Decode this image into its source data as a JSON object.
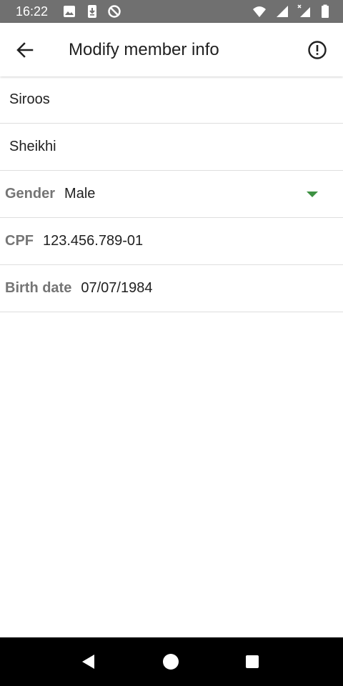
{
  "status_bar": {
    "time": "16:22",
    "icons": [
      "image-icon",
      "download-icon",
      "data-saver-icon",
      "wifi-icon",
      "signal-icon",
      "signal-no-data-icon",
      "battery-icon"
    ]
  },
  "app_bar": {
    "title": "Modify member info",
    "back_icon": "arrow-back-icon",
    "info_icon": "exclamation-circle-icon"
  },
  "form": {
    "first_name": "Siroos",
    "last_name": "Sheikhi",
    "gender": {
      "label": "Gender",
      "value": "Male",
      "caret_color": "#3d9142"
    },
    "cpf": {
      "label": "CPF",
      "value": "123.456.789-01"
    },
    "birth_date": {
      "label": "Birth date",
      "value": "07/07/1984"
    }
  },
  "nav_bar": {
    "buttons": [
      "back-triangle-icon",
      "home-circle-icon",
      "recents-square-icon"
    ]
  },
  "colors": {
    "status_bar": "#707070",
    "label_gray": "#757575",
    "text_dark": "#212121",
    "divider": "#dedede",
    "accent_green": "#3d9142"
  }
}
